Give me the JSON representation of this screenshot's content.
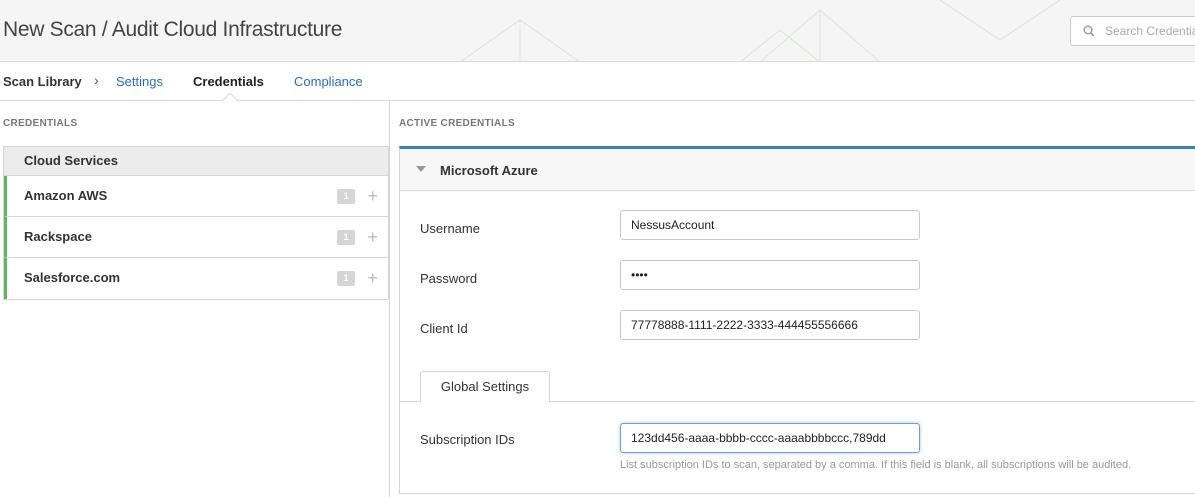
{
  "header": {
    "title": "New Scan / Audit Cloud Infrastructure",
    "search_placeholder": "Search Credentials",
    "search_icon": "search-icon"
  },
  "nav": {
    "scan_library": "Scan Library",
    "separator": "›",
    "settings": "Settings",
    "credentials": "Credentials",
    "compliance": "Compliance"
  },
  "left": {
    "heading": "CREDENTIALS",
    "group": "Cloud Services",
    "items": [
      {
        "label": "Amazon AWS",
        "count": "1",
        "add": "+"
      },
      {
        "label": "Rackspace",
        "count": "1",
        "add": "+"
      },
      {
        "label": "Salesforce.com",
        "count": "1",
        "add": "+"
      }
    ],
    "accent_color": "#5cb85c"
  },
  "right": {
    "heading": "ACTIVE CREDENTIALS",
    "card": {
      "title": "Microsoft Azure",
      "accent_color": "#3a7fc1",
      "fields": {
        "username_label": "Username",
        "username_value": "NessusAccount",
        "password_label": "Password",
        "password_value": "••••",
        "client_id_label": "Client Id",
        "client_id_value": "77778888-1111-2222-3333-444455556666"
      },
      "tab": "Global Settings",
      "subscription_label": "Subscription IDs",
      "subscription_value": "123dd456-aaaa-bbbb-cccc-aaaabbbbccc,789dd",
      "help_text": "List subscription IDs to scan, separated by a comma. If this field is blank, all subscriptions will be audited."
    }
  }
}
